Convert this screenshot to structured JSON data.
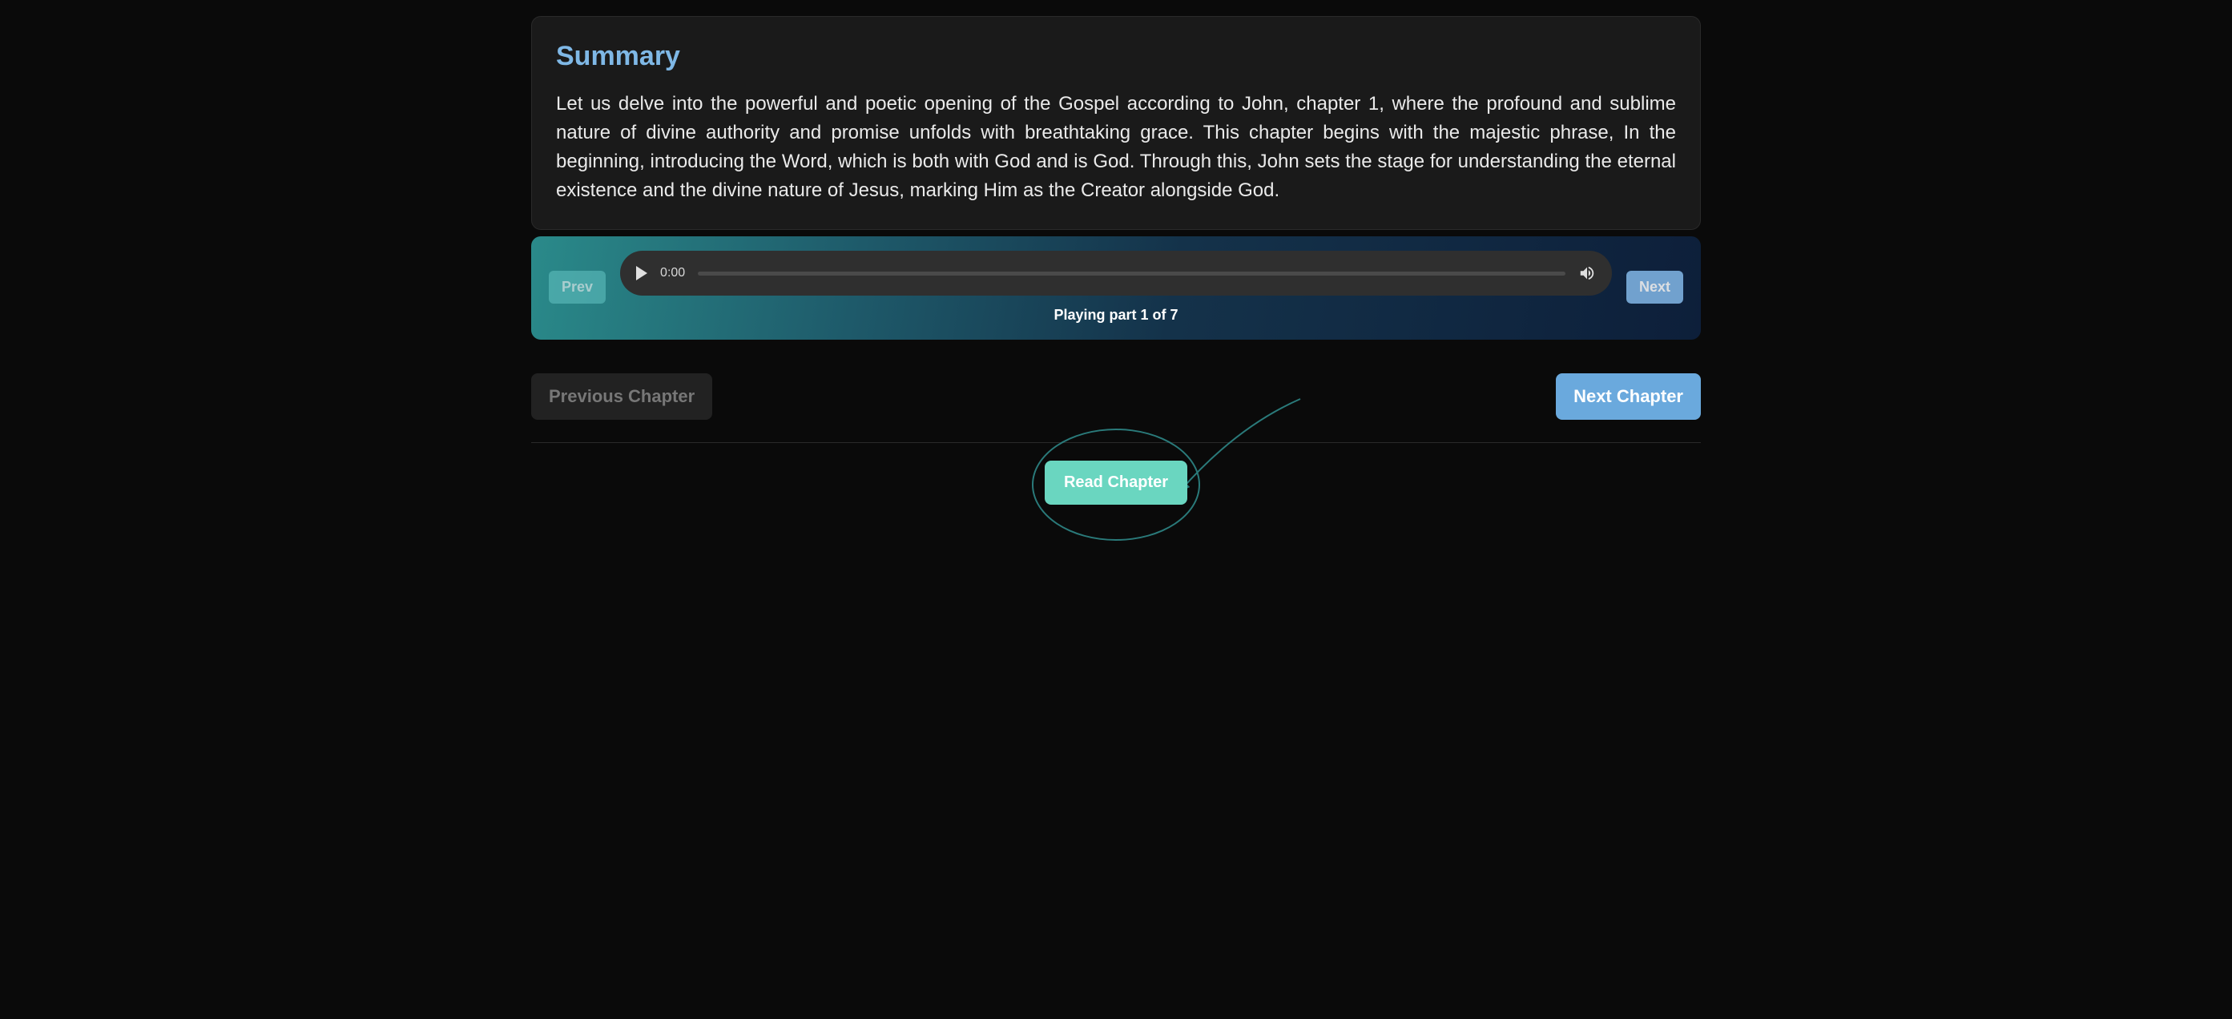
{
  "summary": {
    "title": "Summary",
    "text": "Let us delve into the powerful and poetic opening of the Gospel according to John, chapter 1, where the profound and sublime nature of divine authority and promise unfolds with breathtaking grace. This chapter begins with the majestic phrase, In the beginning, introducing the Word, which is both with God and is God. Through this, John sets the stage for understanding the eternal existence and the divine nature of Jesus, marking Him as the Creator alongside God."
  },
  "player": {
    "prev_label": "Prev",
    "next_label": "Next",
    "time": "0:00",
    "status": "Playing part 1 of 7"
  },
  "nav": {
    "prev_chapter": "Previous Chapter",
    "next_chapter": "Next Chapter",
    "read_chapter": "Read Chapter"
  }
}
